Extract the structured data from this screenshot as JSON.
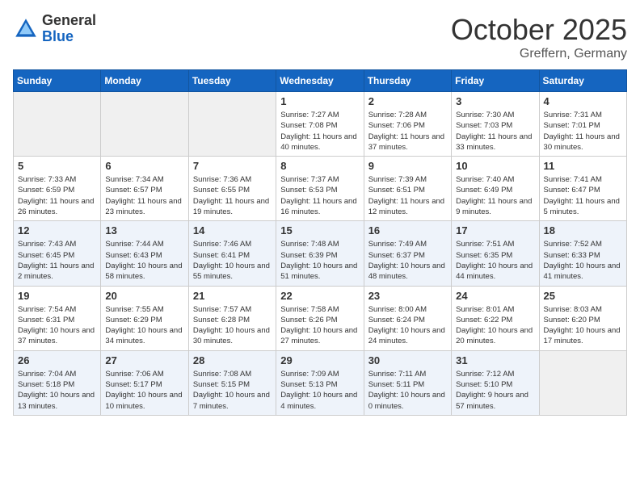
{
  "header": {
    "logo_general": "General",
    "logo_blue": "Blue",
    "month": "October 2025",
    "location": "Greffern, Germany"
  },
  "weekdays": [
    "Sunday",
    "Monday",
    "Tuesday",
    "Wednesday",
    "Thursday",
    "Friday",
    "Saturday"
  ],
  "weeks": [
    [
      {
        "day": null,
        "info": null
      },
      {
        "day": null,
        "info": null
      },
      {
        "day": null,
        "info": null
      },
      {
        "day": "1",
        "info": "Sunrise: 7:27 AM\nSunset: 7:08 PM\nDaylight: 11 hours and 40 minutes."
      },
      {
        "day": "2",
        "info": "Sunrise: 7:28 AM\nSunset: 7:06 PM\nDaylight: 11 hours and 37 minutes."
      },
      {
        "day": "3",
        "info": "Sunrise: 7:30 AM\nSunset: 7:03 PM\nDaylight: 11 hours and 33 minutes."
      },
      {
        "day": "4",
        "info": "Sunrise: 7:31 AM\nSunset: 7:01 PM\nDaylight: 11 hours and 30 minutes."
      }
    ],
    [
      {
        "day": "5",
        "info": "Sunrise: 7:33 AM\nSunset: 6:59 PM\nDaylight: 11 hours and 26 minutes."
      },
      {
        "day": "6",
        "info": "Sunrise: 7:34 AM\nSunset: 6:57 PM\nDaylight: 11 hours and 23 minutes."
      },
      {
        "day": "7",
        "info": "Sunrise: 7:36 AM\nSunset: 6:55 PM\nDaylight: 11 hours and 19 minutes."
      },
      {
        "day": "8",
        "info": "Sunrise: 7:37 AM\nSunset: 6:53 PM\nDaylight: 11 hours and 16 minutes."
      },
      {
        "day": "9",
        "info": "Sunrise: 7:39 AM\nSunset: 6:51 PM\nDaylight: 11 hours and 12 minutes."
      },
      {
        "day": "10",
        "info": "Sunrise: 7:40 AM\nSunset: 6:49 PM\nDaylight: 11 hours and 9 minutes."
      },
      {
        "day": "11",
        "info": "Sunrise: 7:41 AM\nSunset: 6:47 PM\nDaylight: 11 hours and 5 minutes."
      }
    ],
    [
      {
        "day": "12",
        "info": "Sunrise: 7:43 AM\nSunset: 6:45 PM\nDaylight: 11 hours and 2 minutes."
      },
      {
        "day": "13",
        "info": "Sunrise: 7:44 AM\nSunset: 6:43 PM\nDaylight: 10 hours and 58 minutes."
      },
      {
        "day": "14",
        "info": "Sunrise: 7:46 AM\nSunset: 6:41 PM\nDaylight: 10 hours and 55 minutes."
      },
      {
        "day": "15",
        "info": "Sunrise: 7:48 AM\nSunset: 6:39 PM\nDaylight: 10 hours and 51 minutes."
      },
      {
        "day": "16",
        "info": "Sunrise: 7:49 AM\nSunset: 6:37 PM\nDaylight: 10 hours and 48 minutes."
      },
      {
        "day": "17",
        "info": "Sunrise: 7:51 AM\nSunset: 6:35 PM\nDaylight: 10 hours and 44 minutes."
      },
      {
        "day": "18",
        "info": "Sunrise: 7:52 AM\nSunset: 6:33 PM\nDaylight: 10 hours and 41 minutes."
      }
    ],
    [
      {
        "day": "19",
        "info": "Sunrise: 7:54 AM\nSunset: 6:31 PM\nDaylight: 10 hours and 37 minutes."
      },
      {
        "day": "20",
        "info": "Sunrise: 7:55 AM\nSunset: 6:29 PM\nDaylight: 10 hours and 34 minutes."
      },
      {
        "day": "21",
        "info": "Sunrise: 7:57 AM\nSunset: 6:28 PM\nDaylight: 10 hours and 30 minutes."
      },
      {
        "day": "22",
        "info": "Sunrise: 7:58 AM\nSunset: 6:26 PM\nDaylight: 10 hours and 27 minutes."
      },
      {
        "day": "23",
        "info": "Sunrise: 8:00 AM\nSunset: 6:24 PM\nDaylight: 10 hours and 24 minutes."
      },
      {
        "day": "24",
        "info": "Sunrise: 8:01 AM\nSunset: 6:22 PM\nDaylight: 10 hours and 20 minutes."
      },
      {
        "day": "25",
        "info": "Sunrise: 8:03 AM\nSunset: 6:20 PM\nDaylight: 10 hours and 17 minutes."
      }
    ],
    [
      {
        "day": "26",
        "info": "Sunrise: 7:04 AM\nSunset: 5:18 PM\nDaylight: 10 hours and 13 minutes."
      },
      {
        "day": "27",
        "info": "Sunrise: 7:06 AM\nSunset: 5:17 PM\nDaylight: 10 hours and 10 minutes."
      },
      {
        "day": "28",
        "info": "Sunrise: 7:08 AM\nSunset: 5:15 PM\nDaylight: 10 hours and 7 minutes."
      },
      {
        "day": "29",
        "info": "Sunrise: 7:09 AM\nSunset: 5:13 PM\nDaylight: 10 hours and 4 minutes."
      },
      {
        "day": "30",
        "info": "Sunrise: 7:11 AM\nSunset: 5:11 PM\nDaylight: 10 hours and 0 minutes."
      },
      {
        "day": "31",
        "info": "Sunrise: 7:12 AM\nSunset: 5:10 PM\nDaylight: 9 hours and 57 minutes."
      },
      {
        "day": null,
        "info": null
      }
    ]
  ]
}
